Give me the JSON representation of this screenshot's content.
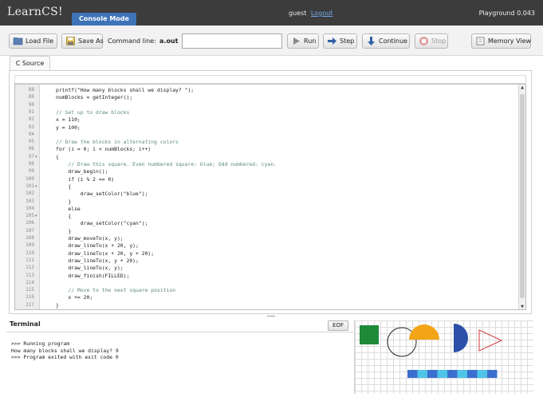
{
  "header": {
    "logo": "LearnCS!",
    "mode_tab": "Console Mode",
    "user": "guest",
    "logout": "Logout",
    "version": "Playground 0.043"
  },
  "toolbar": {
    "load_file": "Load File",
    "save_as": "Save As",
    "command_line_label": "Command line:",
    "command_value": "a.out",
    "command_input_value": "",
    "run": "Run",
    "step": "Step",
    "continue": "Continue",
    "stop": "Stop",
    "memory_view": "Memory View"
  },
  "editor": {
    "tab": "C Source",
    "lines": [
      {
        "n": "88",
        "fold": false,
        "kind": "code",
        "text": "printf(\"How many blocks shall we display? \");"
      },
      {
        "n": "89",
        "fold": false,
        "kind": "code",
        "text": "numBlocks = getInteger();"
      },
      {
        "n": "90",
        "fold": false,
        "kind": "code",
        "text": ""
      },
      {
        "n": "91",
        "fold": false,
        "kind": "comment",
        "text": "// Set up to draw blocks"
      },
      {
        "n": "92",
        "fold": false,
        "kind": "code",
        "text": "x = 110;"
      },
      {
        "n": "93",
        "fold": false,
        "kind": "code",
        "text": "y = 100;"
      },
      {
        "n": "94",
        "fold": false,
        "kind": "code",
        "text": ""
      },
      {
        "n": "95",
        "fold": false,
        "kind": "comment",
        "text": "// Draw the blocks in alternating colors"
      },
      {
        "n": "96",
        "fold": false,
        "kind": "code",
        "text": "for (i = 0; i < numBlocks; i++)"
      },
      {
        "n": "97",
        "fold": true,
        "kind": "code",
        "text": "{"
      },
      {
        "n": "98",
        "fold": false,
        "kind": "comment",
        "text": "    // Draw this square. Even numbered square: blue; Odd numbered: cyan."
      },
      {
        "n": "99",
        "fold": false,
        "kind": "code",
        "text": "    draw_begin();"
      },
      {
        "n": "100",
        "fold": false,
        "kind": "code",
        "text": "    if (i % 2 == 0)"
      },
      {
        "n": "101",
        "fold": true,
        "kind": "code",
        "text": "    {"
      },
      {
        "n": "102",
        "fold": false,
        "kind": "code",
        "text": "        draw_setColor(\"blue\");"
      },
      {
        "n": "103",
        "fold": false,
        "kind": "code",
        "text": "    }"
      },
      {
        "n": "104",
        "fold": false,
        "kind": "code",
        "text": "    else"
      },
      {
        "n": "105",
        "fold": true,
        "kind": "code",
        "text": "    {"
      },
      {
        "n": "106",
        "fold": false,
        "kind": "code",
        "text": "        draw_setColor(\"cyan\");"
      },
      {
        "n": "107",
        "fold": false,
        "kind": "code",
        "text": "    }"
      },
      {
        "n": "108",
        "fold": false,
        "kind": "code",
        "text": "    draw_moveTo(x, y);"
      },
      {
        "n": "109",
        "fold": false,
        "kind": "code",
        "text": "    draw_lineTo(x + 20, y);"
      },
      {
        "n": "110",
        "fold": false,
        "kind": "code",
        "text": "    draw_lineTo(x + 20, y + 20);"
      },
      {
        "n": "111",
        "fold": false,
        "kind": "code",
        "text": "    draw_lineTo(x, y + 20);"
      },
      {
        "n": "112",
        "fold": false,
        "kind": "code",
        "text": "    draw_lineTo(x, y);"
      },
      {
        "n": "113",
        "fold": false,
        "kind": "code",
        "text": "    draw_finish(FILLED);"
      },
      {
        "n": "114",
        "fold": false,
        "kind": "code",
        "text": ""
      },
      {
        "n": "115",
        "fold": false,
        "kind": "comment",
        "text": "    // Move to the next square position"
      },
      {
        "n": "116",
        "fold": false,
        "kind": "code",
        "text": "    x += 20;"
      },
      {
        "n": "117",
        "fold": false,
        "kind": "code",
        "text": "}"
      }
    ]
  },
  "terminal": {
    "title": "Terminal",
    "eof": "EOF",
    "lines": [
      ">>> Running program",
      "How many blocks shall we display? 9",
      ">>> Program exited with exit code 0"
    ]
  },
  "canvas": {
    "blocks": 9,
    "colors": {
      "square": "#1e8a3a",
      "half_circle": "#f2a516",
      "half_disc": "#2c4fa8",
      "triangle": "#d83a3a",
      "block_even": "#3b6fcf",
      "block_odd": "#4fc4e8"
    }
  }
}
